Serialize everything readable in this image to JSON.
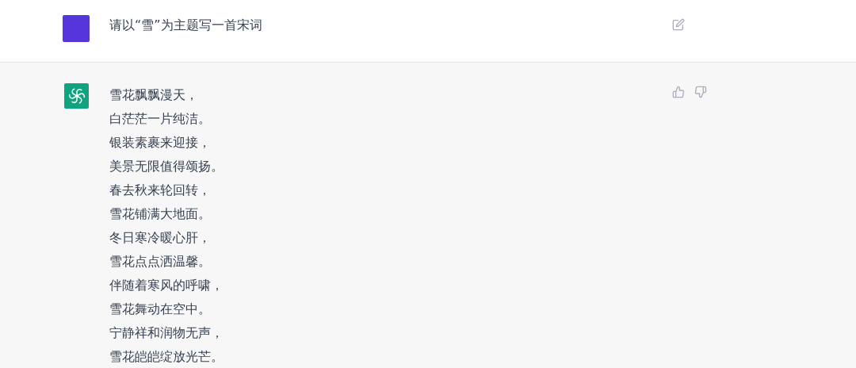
{
  "user_message": {
    "text": "请以“雪”为主题写一首宋词"
  },
  "assistant_message": {
    "lines": [
      "雪花飘飘漫天，",
      "白茫茫一片纯洁。",
      "银装素裹来迎接，",
      "美景无限值得颂扬。",
      "春去秋来轮回转，",
      "雪花铺满大地面。",
      "冬日寒冷暖心肝，",
      "雪花点点洒温馨。",
      "伴随着寒风的呼啸，",
      "雪花舞动在空中。",
      "宁静祥和润物无声，",
      "雪花皑皑绽放光芒。"
    ]
  }
}
